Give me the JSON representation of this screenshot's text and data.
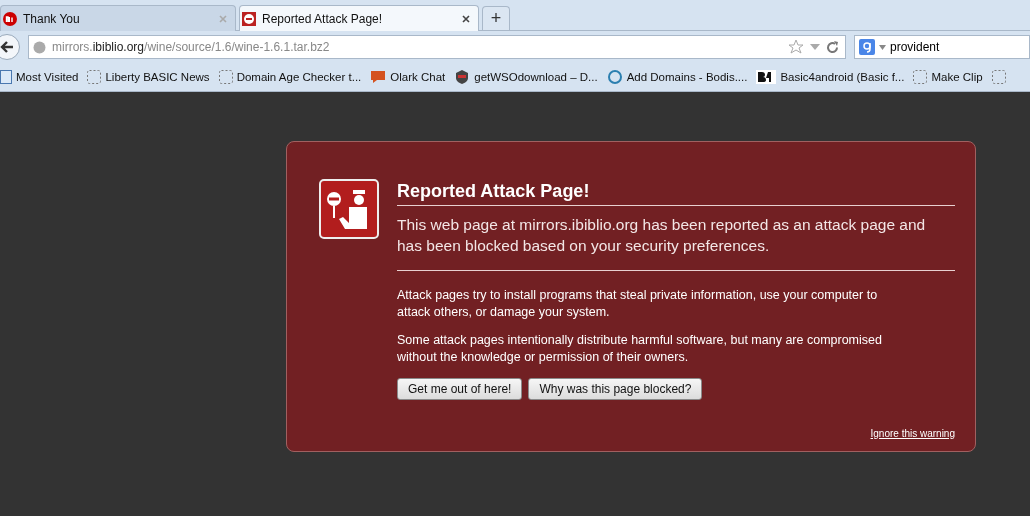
{
  "tabs": [
    {
      "title": "Thank You",
      "kind": "logo",
      "selected": false
    },
    {
      "title": "Reported Attack Page!",
      "kind": "warning",
      "selected": true
    }
  ],
  "new_tab": "+",
  "address": {
    "subdomain": "mirrors.",
    "domain": "ibiblio.org",
    "path": "/wine/source/1.6/wine-1.6.1.tar.bz2"
  },
  "search": {
    "value": "provident"
  },
  "bookmarks": [
    {
      "label": "Most Visited",
      "kind": "page"
    },
    {
      "label": "Liberty BASIC News",
      "kind": "blank"
    },
    {
      "label": "Domain Age Checker t...",
      "kind": "blank"
    },
    {
      "label": "Olark Chat",
      "kind": "chat"
    },
    {
      "label": "getWSOdownload – D...",
      "kind": "badge"
    },
    {
      "label": "Add Domains - Bodis....",
      "kind": "ring"
    },
    {
      "label": "Basic4android (Basic f...",
      "kind": "b4a"
    },
    {
      "label": "Make Clip",
      "kind": "blank"
    },
    {
      "kind": "blank"
    }
  ],
  "warning": {
    "title": "Reported Attack Page!",
    "intro": "This web page at mirrors.ibiblio.org has been reported as an attack page and has been blocked based on your security preferences.",
    "paragraphs": [
      "Attack pages try to install programs that steal private information, use your computer to attack others, or damage your system.",
      "Some attack pages intentionally distribute harmful software, but many are compromised without the knowledge or permission of their owners."
    ],
    "buttons": [
      "Get me out of here!",
      "Why was this page blocked?"
    ],
    "ignore_link": "Ignore this warning"
  }
}
